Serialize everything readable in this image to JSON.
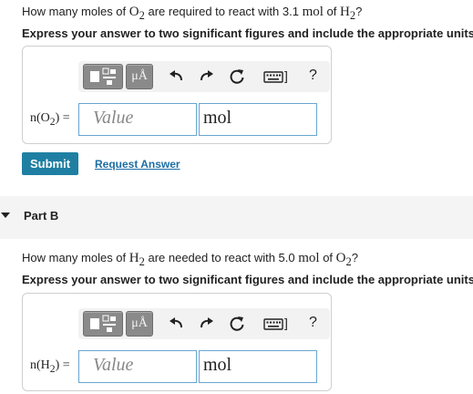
{
  "part_a": {
    "question_prefix": "How many moles of ",
    "question_reactant": "O",
    "question_reactant_sub": "2",
    "question_middle": " are required to react with 3.1 ",
    "question_unit": "mol",
    "question_of": " of ",
    "question_given": "H",
    "question_given_sub": "2",
    "question_suffix": "?",
    "instruction": "Express your answer to two significant figures and include the appropriate units.",
    "field_label": "n(O",
    "field_label_sub": "2",
    "field_label_end": ") =",
    "value_placeholder": "Value",
    "unit_value": "mol",
    "submit_label": "Submit",
    "request_answer_label": "Request Answer"
  },
  "part_b": {
    "title": "Part B",
    "question_prefix": "How many moles of ",
    "question_reactant": "H",
    "question_reactant_sub": "2",
    "question_middle": " are needed to react with 5.0 ",
    "question_unit": "mol",
    "question_of": " of ",
    "question_given": "O",
    "question_given_sub": "2",
    "question_suffix": "?",
    "instruction": "Express your answer to two significant figures and include the appropriate units.",
    "field_label": "n(H",
    "field_label_sub": "2",
    "field_label_end": ") =",
    "value_placeholder": "Value",
    "unit_value": "mol"
  },
  "toolbar": {
    "units_symbol": "μÅ",
    "help_symbol": "?",
    "keyboard_bracket": "]"
  },
  "icons": {
    "templates": "templates-icon",
    "units": "units-mu-angstrom-icon",
    "undo": "undo-icon",
    "redo": "redo-icon",
    "reset": "reset-icon",
    "keyboard": "keyboard-icon",
    "help": "help-icon",
    "collapse": "caret-down-icon"
  },
  "colors": {
    "submit": "#1f7fa3",
    "link": "#1c6ea4",
    "input_border": "#6aa6cf",
    "toolbar_button": "#8a8a8a"
  }
}
